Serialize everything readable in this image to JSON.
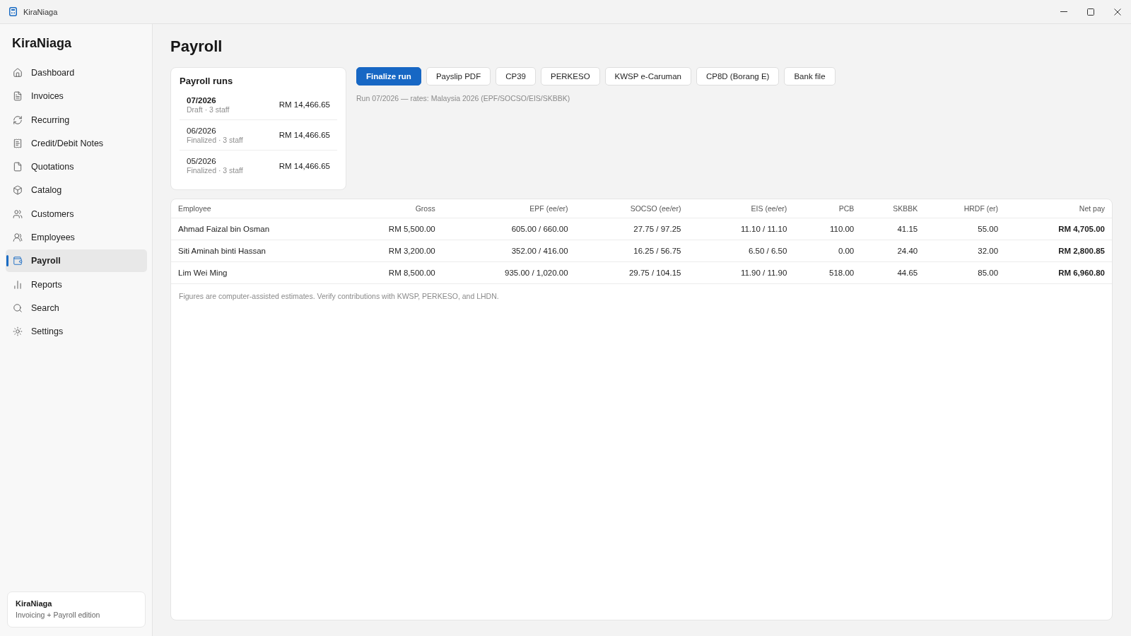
{
  "window": {
    "title": "KiraNiaga"
  },
  "sidebar": {
    "brand": "KiraNiaga",
    "items": [
      {
        "label": "Dashboard",
        "selected": false
      },
      {
        "label": "Invoices",
        "selected": false
      },
      {
        "label": "Recurring",
        "selected": false
      },
      {
        "label": "Credit/Debit Notes",
        "selected": false
      },
      {
        "label": "Quotations",
        "selected": false
      },
      {
        "label": "Catalog",
        "selected": false
      },
      {
        "label": "Customers",
        "selected": false
      },
      {
        "label": "Employees",
        "selected": false
      },
      {
        "label": "Payroll",
        "selected": true
      },
      {
        "label": "Reports",
        "selected": false
      },
      {
        "label": "Search",
        "selected": false
      },
      {
        "label": "Settings",
        "selected": false
      }
    ],
    "footer": {
      "title": "KiraNiaga",
      "subtitle": "Invoicing + Payroll edition"
    }
  },
  "page": {
    "title": "Payroll"
  },
  "payroll_runs": {
    "title": "Payroll runs",
    "runs": [
      {
        "period": "07/2026",
        "meta": "Draft · 3 staff",
        "total": "RM 14,466.65",
        "selected": true
      },
      {
        "period": "06/2026",
        "meta": "Finalized · 3 staff",
        "total": "RM 14,466.65",
        "selected": false
      },
      {
        "period": "05/2026",
        "meta": "Finalized · 3 staff",
        "total": "RM 14,466.65",
        "selected": false
      }
    ]
  },
  "actions": [
    {
      "label": "Finalize run",
      "kind": "primary"
    },
    {
      "label": "Payslip PDF",
      "kind": "secondary"
    },
    {
      "label": "CP39",
      "kind": "secondary"
    },
    {
      "label": "PERKESO",
      "kind": "secondary"
    },
    {
      "label": "KWSP e-Caruman",
      "kind": "secondary"
    },
    {
      "label": "CP8D (Borang E)",
      "kind": "secondary"
    },
    {
      "label": "Bank file",
      "kind": "secondary"
    }
  ],
  "run_info": "Run 07/2026 — rates: Malaysia 2026 (EPF/SOCSO/EIS/SKBBK)",
  "table": {
    "columns": [
      "Employee",
      "Gross",
      "EPF (ee/er)",
      "SOCSO (ee/er)",
      "EIS (ee/er)",
      "PCB",
      "SKBBK",
      "HRDF (er)",
      "Net pay"
    ],
    "rows": [
      {
        "cells": [
          "Ahmad Faizal bin Osman",
          "RM 5,500.00",
          "605.00 / 660.00",
          "27.75 / 97.25",
          "11.10 / 11.10",
          "110.00",
          "41.15",
          "55.00",
          "RM 4,705.00"
        ]
      },
      {
        "cells": [
          "Siti Aminah binti Hassan",
          "RM 3,200.00",
          "352.00 / 416.00",
          "16.25 / 56.75",
          "6.50 / 6.50",
          "0.00",
          "24.40",
          "32.00",
          "RM 2,800.85"
        ]
      },
      {
        "cells": [
          "Lim Wei Ming",
          "RM 8,500.00",
          "935.00 / 1,020.00",
          "29.75 / 104.15",
          "11.90 / 11.90",
          "518.00",
          "44.65",
          "85.00",
          "RM 6,960.80"
        ]
      }
    ],
    "footnote": "Figures are computer-assisted estimates. Verify contributions with KWSP, PERKESO, and LHDN."
  }
}
